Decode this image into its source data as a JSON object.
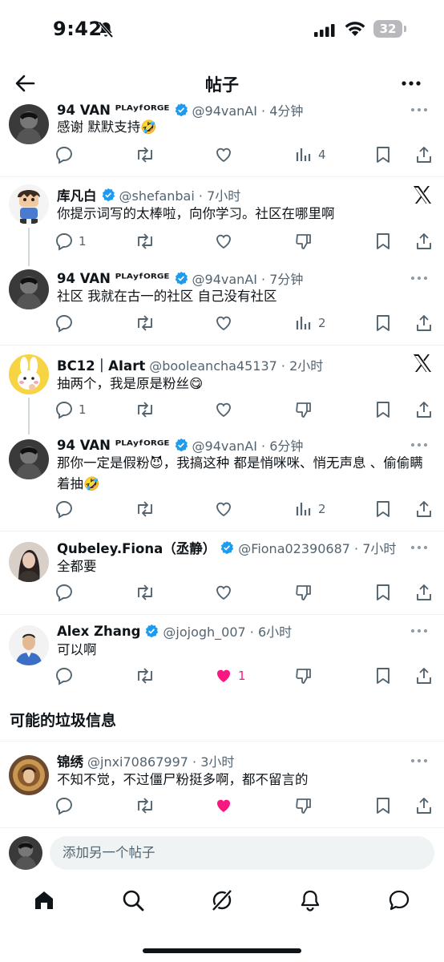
{
  "status": {
    "time": "9:42",
    "battery": "32"
  },
  "nav": {
    "title": "帖子"
  },
  "posts": [
    {
      "name": "94 VAN ᴾᴸᴬʸᶠᴼᴿᴳᴱ",
      "handle": "@94vanAI · 4分钟",
      "text": "感谢 默默支持🤣",
      "reply": "",
      "repost": "",
      "like": "",
      "views": "4"
    },
    {
      "name": "库凡白",
      "handle": "@shefanbai · 7小时",
      "text": "你提示词写的太棒啦，向你学习。社区在哪里啊",
      "reply": "1",
      "repost": "",
      "like": "",
      "views": ""
    },
    {
      "name": "94 VAN ᴾᴸᴬʸᶠᴼᴿᴳᴱ",
      "handle": "@94vanAI · 7分钟",
      "text": "社区 我就在古一的社区  自己没有社区",
      "reply": "",
      "repost": "",
      "like": "",
      "views": "2"
    },
    {
      "name": "BC12｜AIart",
      "handle": "@booleancha45137 · 2小时",
      "text": "抽两个，我是原是粉丝😋",
      "reply": "1",
      "repost": "",
      "like": "",
      "views": ""
    },
    {
      "name": "94 VAN ᴾᴸᴬʸᶠᴼᴿᴳᴱ",
      "handle": "@94vanAI · 6分钟",
      "text": "那你一定是假粉😈，我搞这种 都是悄咪咪、悄无声息 、偷偷瞒着抽🤣",
      "reply": "",
      "repost": "",
      "like": "",
      "views": "2"
    },
    {
      "name": "Qubeley.Fiona（丞静）",
      "handle": "@Fiona02390687 · 7小时",
      "text": "全都要",
      "reply": "",
      "repost": "",
      "like": "",
      "views": ""
    },
    {
      "name": "Alex Zhang",
      "handle": "@jojogh_007 · 6小时",
      "text": "可以啊",
      "reply": "",
      "repost": "",
      "like": "1",
      "views": ""
    },
    {
      "name": "锦绣",
      "handle": "@jnxi70867997 · 3小时",
      "text": "不知不觉，不过僵尸粉挺多啊，都不留言的",
      "reply": "",
      "repost": "",
      "like": "",
      "views": ""
    }
  ],
  "section_title": "可能的垃圾信息",
  "compose": {
    "placeholder": "添加另一个帖子"
  },
  "colors": {
    "blue": "#1d9bf0",
    "pink": "#f91880",
    "gray": "#536471"
  }
}
